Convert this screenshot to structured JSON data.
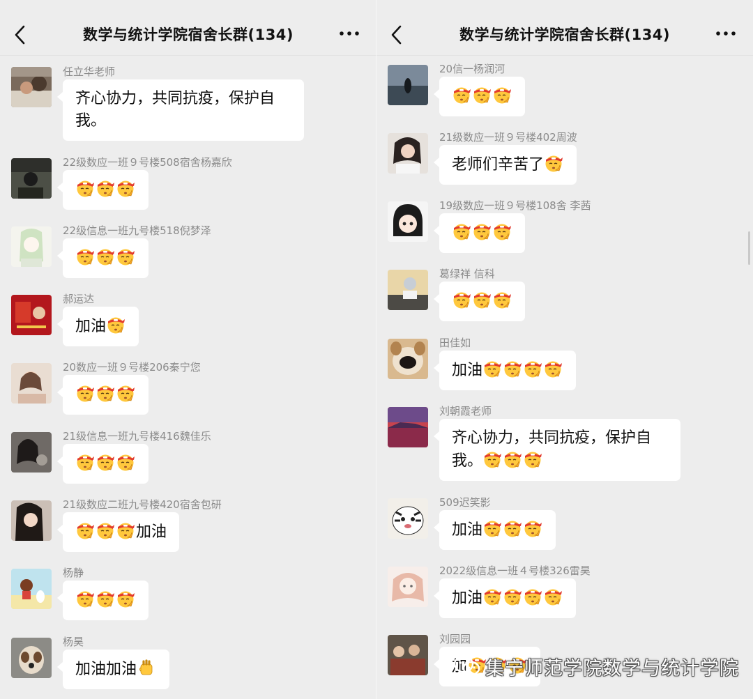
{
  "left": {
    "header": {
      "title": "数学与统计学院宿舍长群(134)"
    },
    "messages": [
      {
        "sender": "任立华老师",
        "text": "齐心协力，共同抗疫，保护自",
        "text2": "我。"
      },
      {
        "sender": "22级数应一班９号楼508宿舍杨嘉欣",
        "text": ""
      },
      {
        "sender": "22级信息一班九号楼518倪梦泽",
        "text": ""
      },
      {
        "sender": "郝运达",
        "text": "加油"
      },
      {
        "sender": "20数应一班９号楼206秦宁您",
        "text": ""
      },
      {
        "sender": "21级信息一班九号楼416魏佳乐",
        "text": ""
      },
      {
        "sender": "21级数应二班九号楼420宿舍包研",
        "text": "加油"
      },
      {
        "sender": "杨静",
        "text": ""
      },
      {
        "sender": "杨昊",
        "text": "加油加油"
      }
    ]
  },
  "right": {
    "header": {
      "title": "数学与统计学院宿舍长群(134)"
    },
    "messages": [
      {
        "sender": "20信一杨润河",
        "text": ""
      },
      {
        "sender": "21级数应一班９号楼402周波",
        "text": "老师们辛苦了"
      },
      {
        "sender": "19级数应一班９号楼108舍 李茜",
        "text": ""
      },
      {
        "sender": "葛绿祥  信科",
        "text": ""
      },
      {
        "sender": "田佳如",
        "text": "加油"
      },
      {
        "sender": "刘朝霞老师",
        "text": "齐心协力，共同抗疫，保护自",
        "text2": "我。"
      },
      {
        "sender": "509迟笑影",
        "text": "加油"
      },
      {
        "sender": "2022级信息一班４号楼326雷昊",
        "text": "加油"
      },
      {
        "sender": "刘园园",
        "text": "加"
      }
    ]
  },
  "watermark": {
    "text": "集宁师范学院数学与统计学院"
  },
  "icons": {
    "back": "chevron-left-icon",
    "more": "ellipsis-icon",
    "emoji": "fighting-headband-emoji",
    "fist": "raised-fist-emoji",
    "watermark": "wechat-official-account-icon"
  },
  "colors": {
    "background": "#ededed",
    "bubble": "#ffffff",
    "sender": "#8a8a8a",
    "text": "#111111"
  }
}
